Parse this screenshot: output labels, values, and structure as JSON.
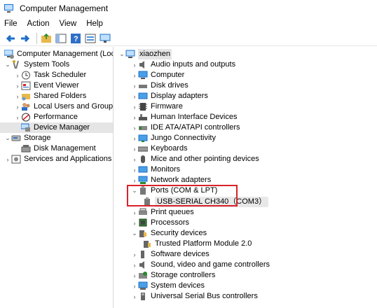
{
  "window": {
    "title": "Computer Management"
  },
  "menu": [
    "File",
    "Action",
    "View",
    "Help"
  ],
  "toolbar": {
    "buttons": [
      "back-icon",
      "forward-icon",
      "up-folder-icon",
      "show-hide-tree-icon",
      "help-icon",
      "properties-icon",
      "monitor-icon"
    ]
  },
  "left_tree": {
    "root": "Computer Management (Local",
    "system_tools": "System Tools",
    "task_scheduler": "Task Scheduler",
    "event_viewer": "Event Viewer",
    "shared_folders": "Shared Folders",
    "local_users": "Local Users and Groups",
    "performance": "Performance",
    "device_manager": "Device Manager",
    "storage": "Storage",
    "disk_management": "Disk Management",
    "services": "Services and Applications"
  },
  "device_tree": {
    "computer_name": "xiaozhen",
    "categories": [
      "Audio inputs and outputs",
      "Computer",
      "Disk drives",
      "Display adapters",
      "Firmware",
      "Human Interface Devices",
      "IDE ATA/ATAPI controllers",
      "Jungo Connectivity",
      "Keyboards",
      "Mice and other pointing devices",
      "Monitors",
      "Network adapters",
      "Ports (COM & LPT)",
      "Print queues",
      "Processors",
      "Security devices",
      "Software devices",
      "Sound, video and game controllers",
      "Storage controllers",
      "System devices",
      "Universal Serial Bus controllers"
    ],
    "ports_child": "USB-SERIAL CH340（COM3）",
    "security_child": "Trusted Platform Module 2.0"
  },
  "colors": {
    "highlight": "#d9212a",
    "selection": "#e5e5e5",
    "accent_blue": "#1e6fc8"
  }
}
